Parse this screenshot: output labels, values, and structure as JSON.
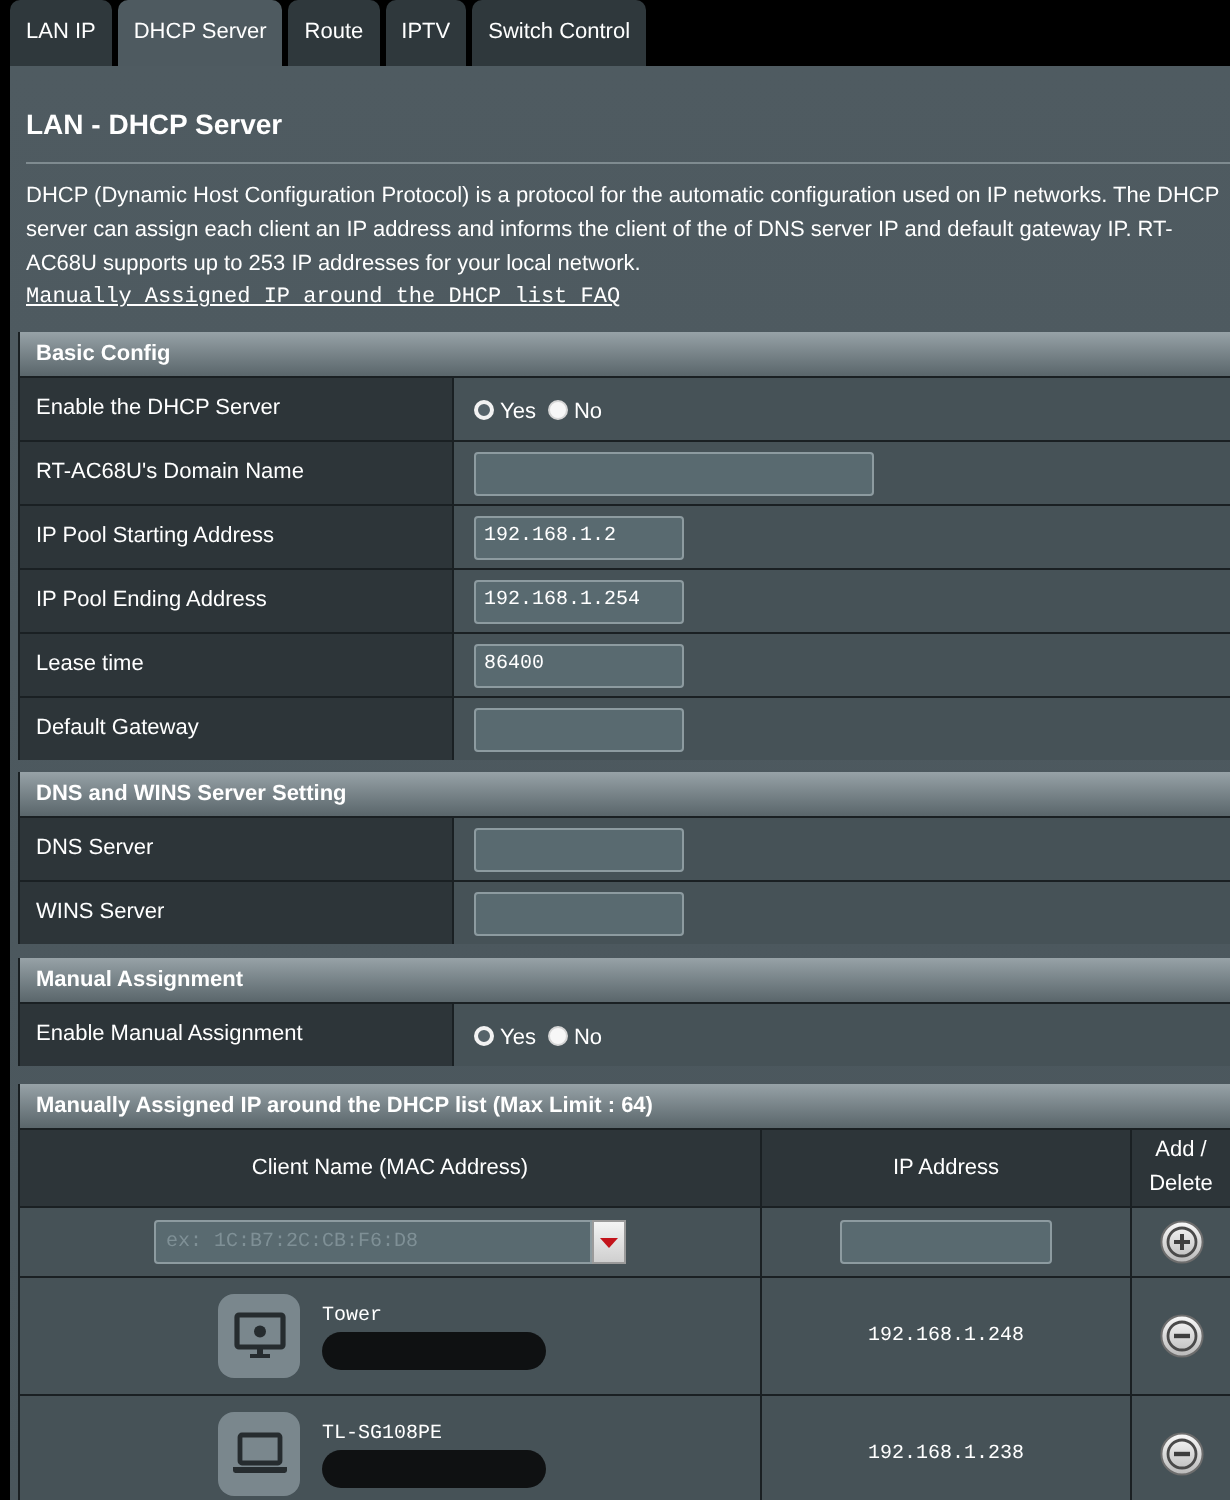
{
  "tabs": [
    {
      "label": "LAN IP",
      "selected": false
    },
    {
      "label": "DHCP Server",
      "selected": true
    },
    {
      "label": "Route",
      "selected": false
    },
    {
      "label": "IPTV",
      "selected": false
    },
    {
      "label": "Switch Control",
      "selected": false
    }
  ],
  "page": {
    "title": "LAN - DHCP Server",
    "description": "DHCP (Dynamic Host Configuration Protocol) is a protocol for the automatic configuration used on IP networks. The DHCP server can assign each client an IP address and informs the client of the of DNS server IP and default gateway IP. RT-AC68U supports up to 253 IP addresses for your local network.",
    "faq_link": "Manually Assigned IP around the DHCP list FAQ"
  },
  "sections": [
    {
      "title": "Basic Config",
      "rows": [
        {
          "kind": "radio",
          "label": "Enable the DHCP Server",
          "options": [
            {
              "label": "Yes",
              "selected": true
            },
            {
              "label": "No",
              "selected": false
            }
          ]
        },
        {
          "kind": "wide-field",
          "label": "RT-AC68U's Domain Name"
        },
        {
          "kind": "field",
          "label": "IP Pool Starting Address",
          "value": "192.168.1.2"
        },
        {
          "kind": "field",
          "label": "IP Pool Ending Address",
          "value": "192.168.1.254"
        },
        {
          "kind": "field",
          "label": "Lease time",
          "value": "86400"
        },
        {
          "kind": "field",
          "label": "Default Gateway"
        }
      ]
    },
    {
      "title": "DNS and WINS Server Setting",
      "rows": [
        {
          "kind": "field",
          "label": "DNS Server"
        },
        {
          "kind": "field",
          "label": "WINS Server"
        }
      ]
    },
    {
      "title": "Manual Assignment",
      "rows": [
        {
          "kind": "radio",
          "label": "Enable Manual Assignment",
          "options": [
            {
              "label": "Yes",
              "selected": true
            },
            {
              "label": "No",
              "selected": false
            }
          ]
        }
      ]
    }
  ],
  "assigned_list": {
    "title": "Manually Assigned IP around the DHCP list (Max Limit : 64)",
    "columns": [
      "Client Name (MAC Address)",
      "IP Address",
      "Add / Delete"
    ],
    "new_entry": {
      "mac_field": {
        "placeholder": "ex: 1C:B7:2C:CB:F6:D8"
      }
    },
    "clients": [
      {
        "kind": "desktop",
        "name": "Tower",
        "ip": "192.168.1.248"
      },
      {
        "kind": "laptop",
        "name": "TL-SG108PE",
        "ip": "192.168.1.238"
      }
    ]
  }
}
